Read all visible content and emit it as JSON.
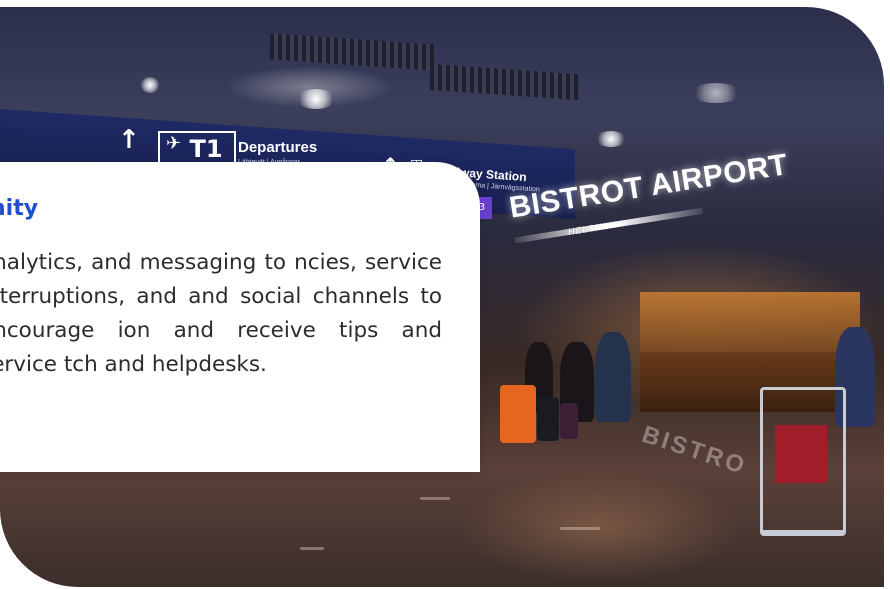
{
  "signage": {
    "terminal": "T1",
    "departures": "Departures",
    "departures_sub": "Lähtevät | Avgångar",
    "railway": "Railway Station",
    "railway_sub": "Rautatieasema | Järnvägsstation",
    "platform_badge": "3",
    "bistro_name": "BISTROT AIRPORT",
    "bistro_city": "HELSINKI",
    "floor_text": "BISTRO",
    "icon_names": [
      "up-arrow-icon",
      "plane-icon",
      "train-icon"
    ]
  },
  "card": {
    "title": "nity",
    "body": "analytics, and messaging to ncies, service interruptions, and and social channels to encourage ion and receive tips and service tch and helpdesks.",
    "title_color": "#1f4fd1",
    "background": "#ffffff"
  }
}
